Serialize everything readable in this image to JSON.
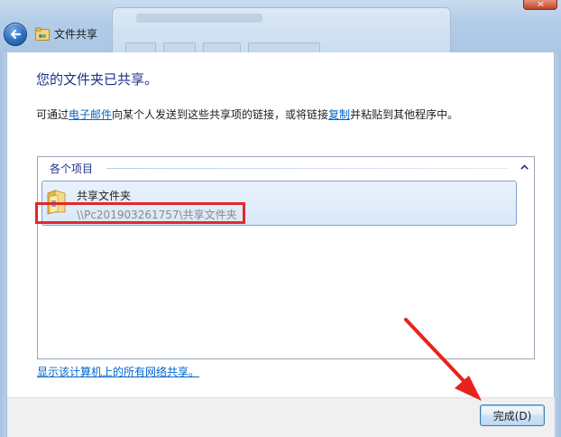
{
  "window": {
    "title": "文件共享"
  },
  "page": {
    "heading": "您的文件夹已共享。",
    "desc_before": "可通过",
    "email_link": "电子邮件",
    "desc_middle": "向某个人发送到这些共享项的链接，或将链接",
    "copy_link": "复制",
    "desc_after": "并粘贴到其他程序中。"
  },
  "items_panel": {
    "group_label": "各个项目",
    "items": [
      {
        "name": "共享文件夹",
        "path": "\\\\Pc201903261757\\共享文件夹"
      }
    ]
  },
  "footer": {
    "all_shares_link": "显示该计算机上的所有网络共享。",
    "done_button": "完成(D)"
  },
  "colors": {
    "heading": "#1e3287",
    "link": "#0066cc",
    "highlight_box": "#e02a2a",
    "annotation_arrow": "#e8231d"
  },
  "icons": {
    "back": "back-arrow-icon",
    "title": "shared-folder-icon",
    "collapse": "chevron-up-icon",
    "item": "folder-icon"
  }
}
